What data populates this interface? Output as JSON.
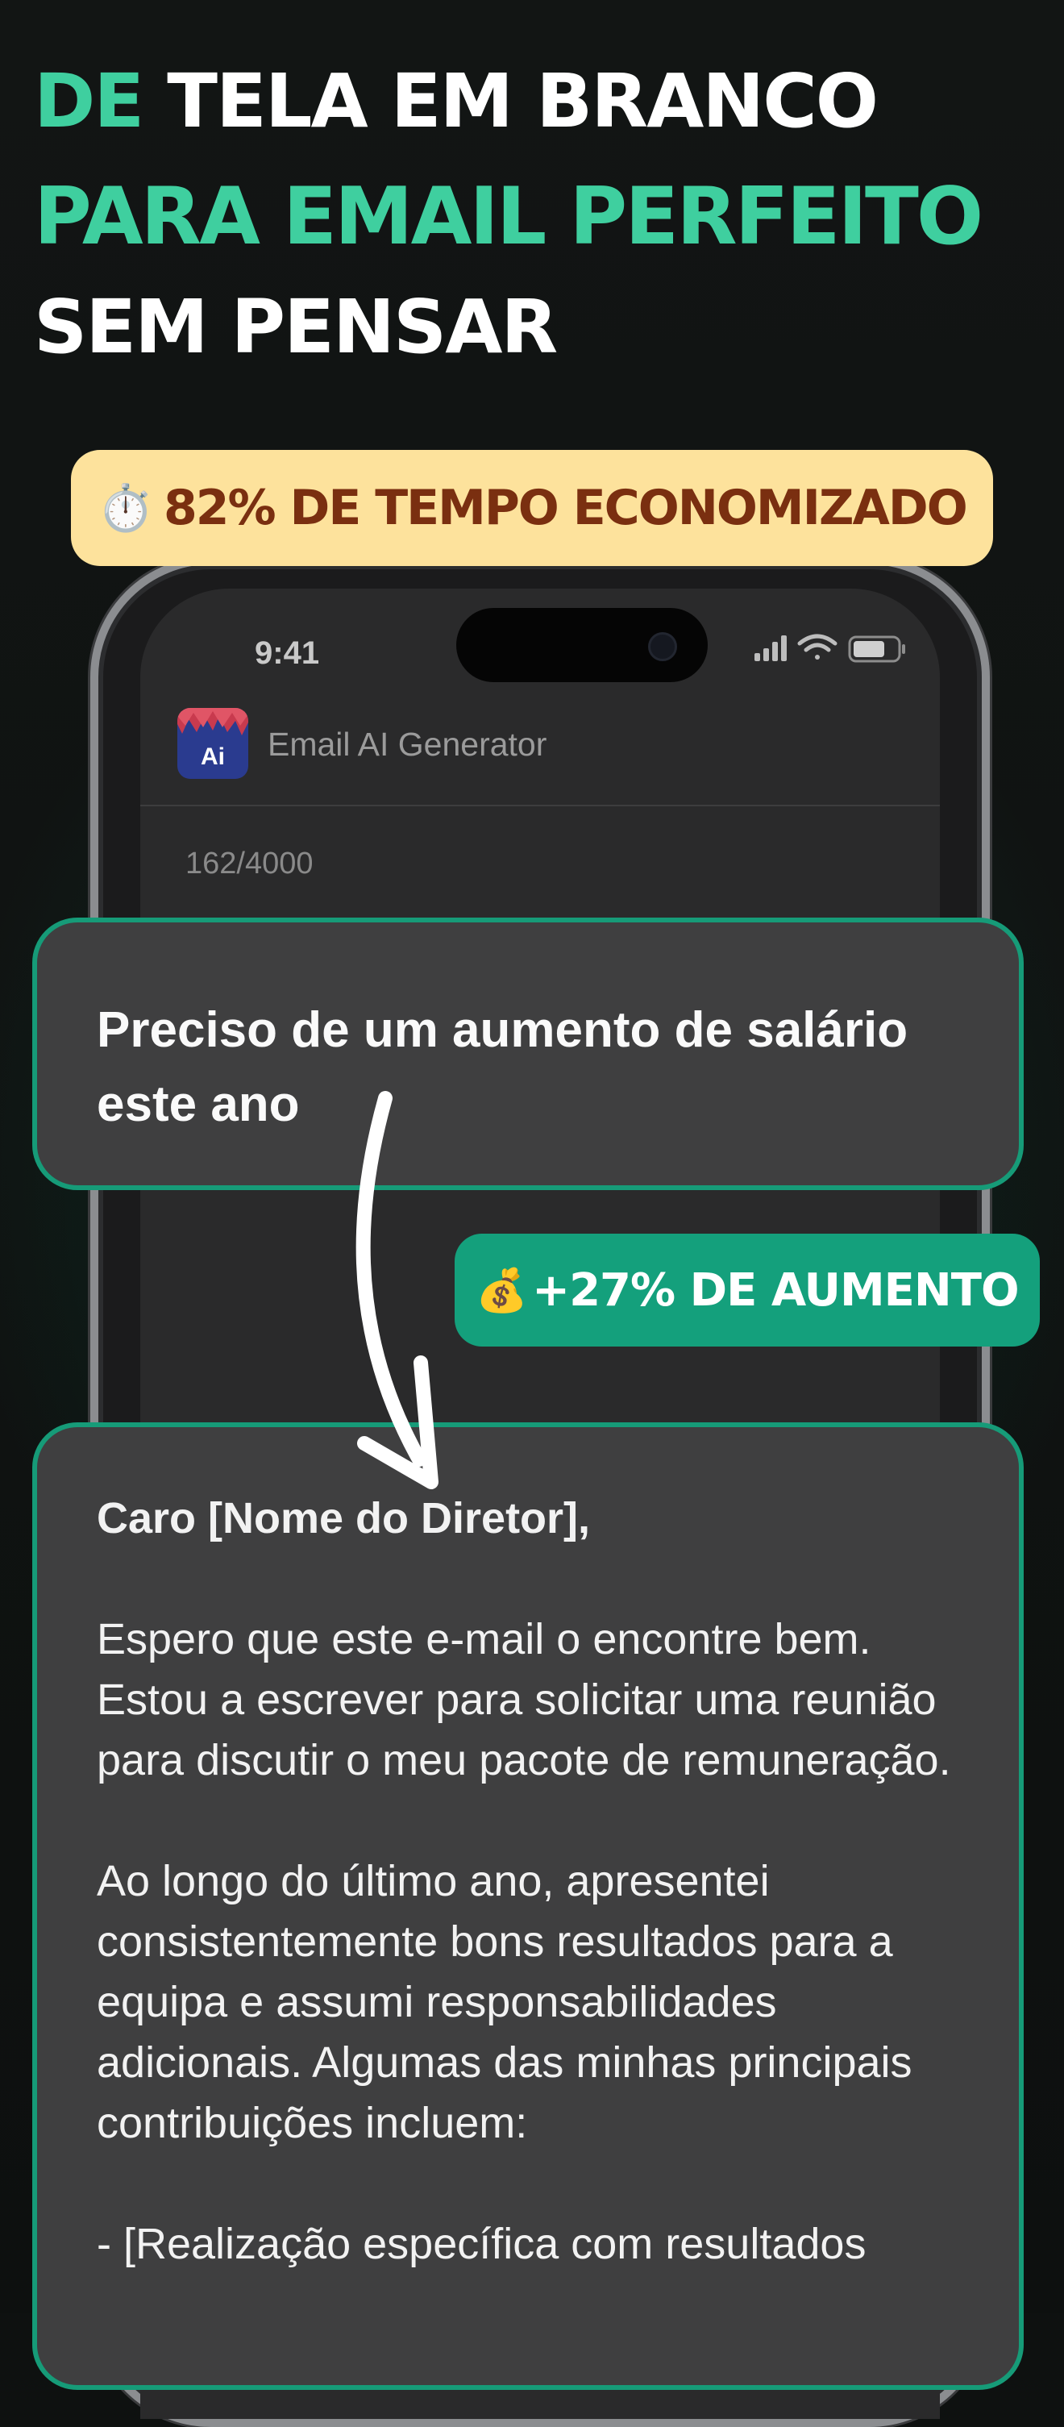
{
  "headline": {
    "line1_accent": "DE",
    "line1_rest": "TELA EM BRANCO",
    "line2": "PARA EMAIL PERFEITO",
    "line3": "SEM PENSAR"
  },
  "badges": {
    "time_saved": {
      "emoji": "⏱️",
      "text": "82% DE TEMPO ECONOMIZADO"
    },
    "raise": {
      "emoji": "💰",
      "text": "+27% DE AUMENTO"
    }
  },
  "phone": {
    "status_time": "9:41",
    "app_icon_label": "Ai",
    "app_title": "Email AI Generator",
    "char_count": "162/4000"
  },
  "prompt_card": {
    "text": "Preciso de um aumento de salário este ano"
  },
  "email_card": {
    "greeting": "Caro [Nome do Diretor],",
    "paragraph1": "Espero que este e-mail o encontre bem. Estou a escrever para solicitar uma reunião para discutir o meu pacote de remuneração.",
    "paragraph2": "Ao longo do último ano, apresentei consistentemente bons resultados para a equipa e assumi responsabilidades adicionais. Algumas das minhas principais contribuições incluem:",
    "bullet1": "- [Realização específica com resultados"
  },
  "colors": {
    "accent_green": "#3fcf9f",
    "card_border": "#169b78",
    "badge_yellow": "#fde29c",
    "badge_yellow_text": "#7a2f10",
    "badge_green": "#14a07c"
  },
  "icons": [
    "stopwatch-icon",
    "money-bag-icon",
    "signal-icon",
    "wifi-icon",
    "battery-icon",
    "curved-arrow-icon"
  ]
}
